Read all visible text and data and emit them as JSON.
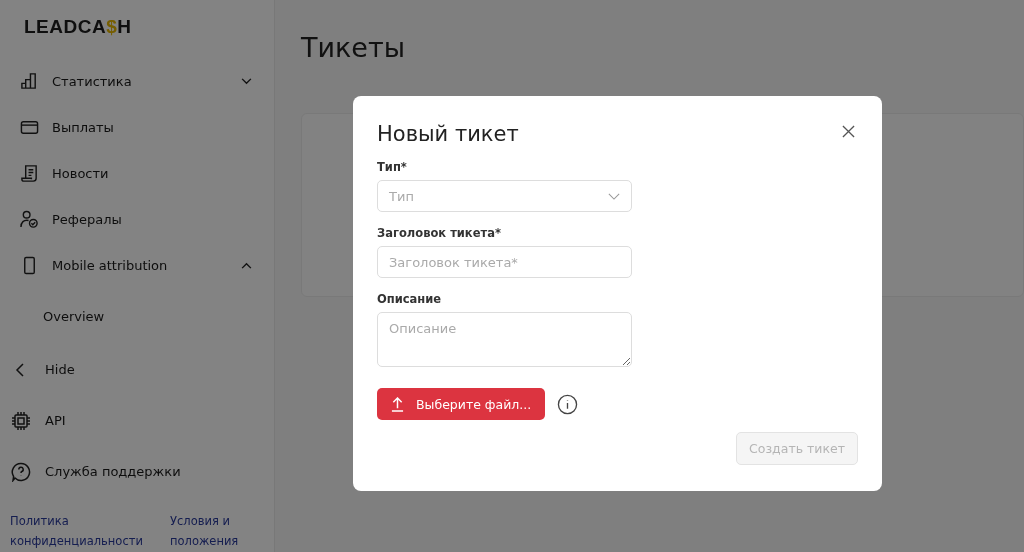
{
  "sidebar": {
    "logo": [
      {
        "text": "LEADCA",
        "accent": false
      },
      {
        "text": "$",
        "accent": true
      },
      {
        "text": "H",
        "accent": false
      }
    ],
    "items": [
      {
        "label": "Статистика",
        "kind": "group",
        "expanded": false
      },
      {
        "label": "Выплаты",
        "kind": "link"
      },
      {
        "label": "Новости",
        "kind": "link"
      },
      {
        "label": "Рефералы",
        "kind": "link"
      },
      {
        "label": "Mobile attribution",
        "kind": "group",
        "expanded": true,
        "children": [
          {
            "label": "Overview"
          }
        ]
      }
    ],
    "bottom_items": [
      {
        "label": "Hide"
      },
      {
        "label": "API"
      },
      {
        "label": "Служба поддержки"
      }
    ],
    "footer_links": [
      "Политика конфиденциальности",
      "Условия и положения"
    ]
  },
  "page": {
    "title": "Тикеты"
  },
  "modal": {
    "title": "Новый тикет",
    "fields": [
      {
        "label": "Тип*",
        "placeholder": "Тип",
        "kind": "select"
      },
      {
        "label": "Заголовок тикета*",
        "placeholder": "Заголовок тикета*",
        "kind": "text"
      },
      {
        "label": "Описание",
        "placeholder": "Описание",
        "kind": "textarea"
      }
    ],
    "upload_button": "Выберите файл...",
    "submit_button": {
      "label": "Создать тикет",
      "disabled": true
    }
  }
}
